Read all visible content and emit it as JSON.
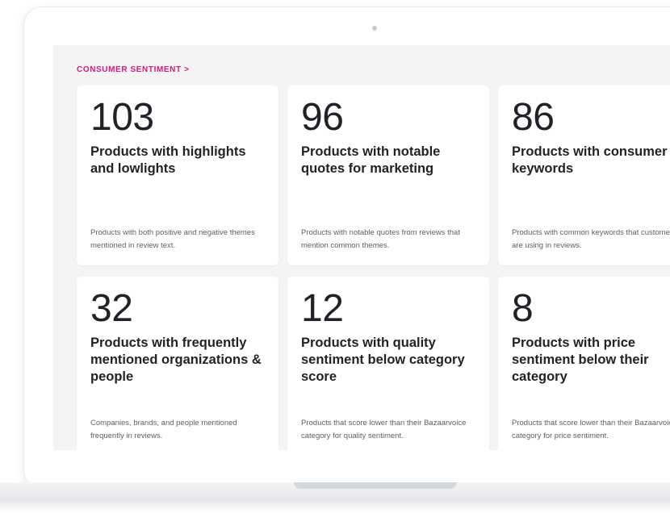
{
  "section": {
    "header": "CONSUMER SENTIMENT >"
  },
  "cards": [
    {
      "metric": "103",
      "title": "Products with highlights and lowlights",
      "desc_lines": [
        "Products with both positive and negative themes",
        "mentioned in review text."
      ]
    },
    {
      "metric": "96",
      "title": "Products with notable quotes for marketing",
      "desc_lines": [
        "Products with notable quotes from reviews that",
        "mention common themes."
      ]
    },
    {
      "metric": "86",
      "title": "Products with consumer keywords",
      "desc_lines": [
        "Products with common keywords that customers",
        "are using in reviews."
      ]
    },
    {
      "metric": "32",
      "title": "Products with frequently mentioned organizations & people",
      "desc_lines": [
        "Companies, brands, and people mentioned",
        "frequently in reviews."
      ]
    },
    {
      "metric": "12",
      "title": "Products with quality sentiment below category score",
      "desc_lines": [
        "Products that score lower than their Bazaarvoice",
        "category for quality sentiment."
      ]
    },
    {
      "metric": "8",
      "title": "Products with price sentiment below their category",
      "desc_lines": [
        "Products that score lower than their Bazaarvoice",
        "category for price sentiment."
      ]
    }
  ]
}
